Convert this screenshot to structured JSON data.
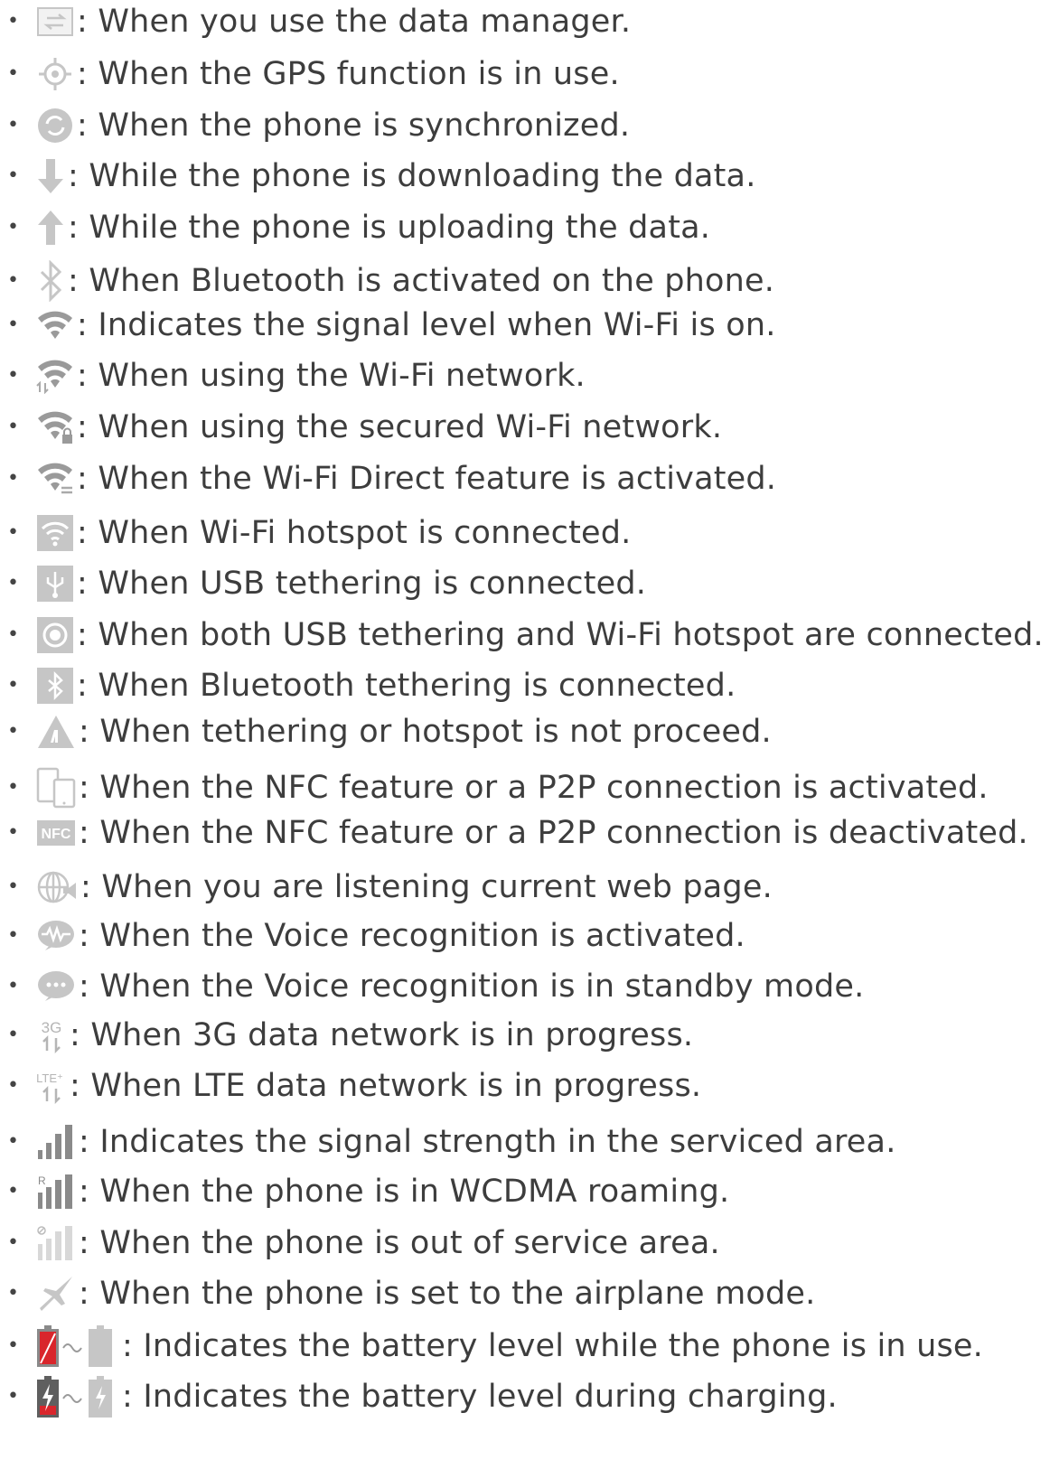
{
  "items": [
    {
      "icon": "data-manager-icon",
      "text": ": When you use the data manager."
    },
    {
      "icon": "gps-icon",
      "text": ": When the GPS function is in use."
    },
    {
      "icon": "sync-icon",
      "text": ": When the phone is synchronized."
    },
    {
      "icon": "download-arrow-icon",
      "text": ": While the phone is downloading the data."
    },
    {
      "icon": "upload-arrow-icon",
      "text": ": While the phone is uploading the data."
    },
    {
      "icon": "bluetooth-icon",
      "text": ": When Bluetooth is activated on the phone."
    },
    {
      "icon": "wifi-signal-icon",
      "text": ": Indicates the signal level when Wi-Fi is on."
    },
    {
      "icon": "wifi-network-in-use-icon",
      "text": ": When using the Wi-Fi network."
    },
    {
      "icon": "wifi-secured-icon",
      "text": ": When using the secured Wi-Fi network."
    },
    {
      "icon": "wifi-direct-icon",
      "text": ": When the Wi-Fi Direct feature is activated."
    },
    {
      "icon": "wifi-hotspot-icon",
      "text": ": When Wi-Fi hotspot is connected."
    },
    {
      "icon": "usb-tethering-icon",
      "text": ": When USB tethering is connected."
    },
    {
      "icon": "usb-and-hotspot-icon",
      "text": ": When both USB tethering and Wi-Fi hotspot are connected."
    },
    {
      "icon": "bluetooth-tethering-icon",
      "text": ": When Bluetooth tethering is connected."
    },
    {
      "icon": "tethering-warning-icon",
      "text": ": When tethering or hotspot is not proceed."
    },
    {
      "icon": "nfc-p2p-icon",
      "text": ": When the NFC feature or a P2P connection is activated."
    },
    {
      "icon": "nfc-off-icon",
      "text": ": When the NFC feature or a P2P connection is deactivated."
    },
    {
      "icon": "web-listen-icon",
      "text": ": When you are listening current web page."
    },
    {
      "icon": "voice-active-icon",
      "text": ": When the Voice recognition is activated."
    },
    {
      "icon": "voice-standby-icon",
      "text": ": When the Voice recognition is in standby mode."
    },
    {
      "icon": "3g-data-icon",
      "text": ": When 3G data network is in progress."
    },
    {
      "icon": "lte-data-icon",
      "text": ": When LTE data network is in progress."
    },
    {
      "icon": "signal-strength-icon",
      "text": ": Indicates the signal strength in the serviced area."
    },
    {
      "icon": "roaming-signal-icon",
      "text": ": When the phone is in WCDMA roaming."
    },
    {
      "icon": "no-service-icon",
      "text": ": When the phone is out of service area."
    },
    {
      "icon": "airplane-icon",
      "text": ": When the phone is set to the airplane mode."
    },
    {
      "icon": "battery-level-icon",
      "text": ": Indicates the battery level while the phone is in use."
    },
    {
      "icon": "battery-charging-icon",
      "text": ": Indicates the battery level during charging."
    }
  ],
  "colors": {
    "icon_gray": "#c6c6c6",
    "icon_dark": "#8a8a8a",
    "battery_red": "#d9262c",
    "text": "#3d3d3d"
  }
}
